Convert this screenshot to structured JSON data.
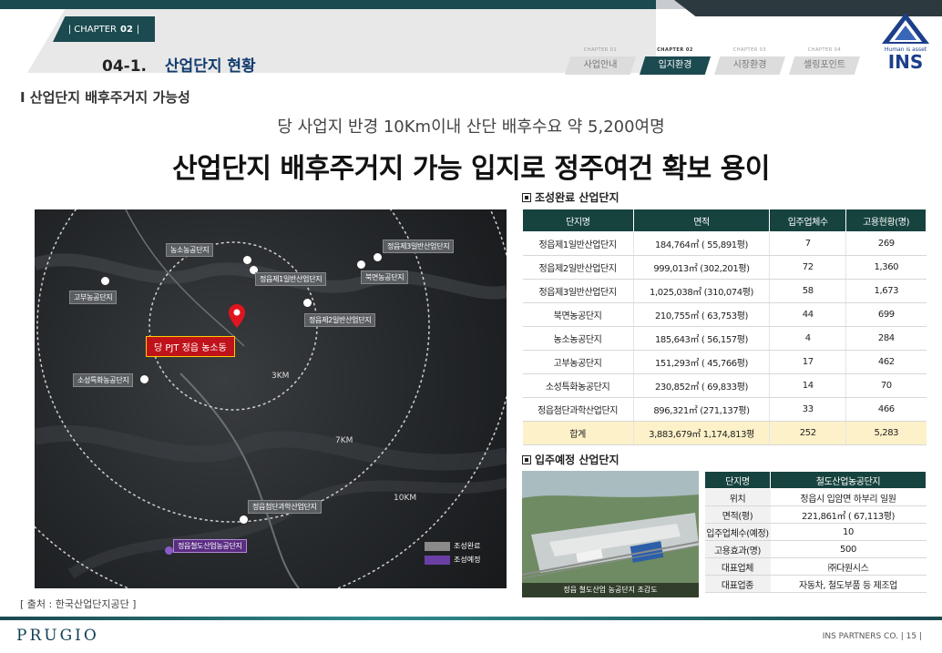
{
  "header": {
    "chapter_prefix": "| CHAPTER",
    "chapter_num": "02",
    "chapter_suffix": "|",
    "section_number": "04-1.",
    "section_title": "산업단지 현황",
    "nav": [
      {
        "caption": "CHAPTER 01",
        "label": "사업안내",
        "active": false
      },
      {
        "caption": "CHAPTER 02",
        "label": "입지환경",
        "active": true
      },
      {
        "caption": "CHAPTER 03",
        "label": "시장환경",
        "active": false
      },
      {
        "caption": "CHAPTER 04",
        "label": "셀링포인트",
        "active": false
      }
    ],
    "logo_tagline": "Human is asset",
    "logo_name": "INS"
  },
  "subheading": "I 산업단지 배후주거지 가능성",
  "summary": "당 사업지 반경 10Km이내 산단 배후수요 약 5,200여명",
  "headline": "산업단지 배후주거지 가능 입지로 정주여건 확보 용이",
  "map": {
    "labels": [
      {
        "text": "농소농공단지",
        "type": "complete"
      },
      {
        "text": "정읍제3일반산업단지",
        "type": "complete"
      },
      {
        "text": "정읍제1일반산업단지",
        "type": "complete"
      },
      {
        "text": "북면농공단지",
        "type": "complete"
      },
      {
        "text": "고부농공단지",
        "type": "complete"
      },
      {
        "text": "정읍제2일반산업단지",
        "type": "complete"
      },
      {
        "text": "소성특화농공단지",
        "type": "complete"
      },
      {
        "text": "정읍첨단과학산업단지",
        "type": "complete"
      },
      {
        "text": "정읍철도산업농공단지",
        "type": "planned"
      }
    ],
    "site_label": "당 PJT 정읍 농소동",
    "rings": [
      "3KM",
      "7KM",
      "10KM"
    ],
    "legend": [
      {
        "text": "조성완료",
        "color": "#8a8a8a"
      },
      {
        "text": "조성예정",
        "color": "#6a3fa5"
      }
    ]
  },
  "source": "[ 출처 : 한국산업단지공단 ]",
  "complete_table": {
    "title": "조성완료 산업단지",
    "headers": [
      "단지명",
      "면적",
      "입주업체수",
      "고용현황(명)"
    ],
    "rows": [
      [
        "정읍제1일반산업단지",
        "184,764㎡ ( 55,891평)",
        "7",
        "269"
      ],
      [
        "정읍제2일반산업단지",
        "999,013㎡ (302,201평)",
        "72",
        "1,360"
      ],
      [
        "정읍제3일반산업단지",
        "1,025,038㎡ (310,074평)",
        "58",
        "1,673"
      ],
      [
        "북면농공단지",
        "210,755㎡ ( 63,753평)",
        "44",
        "699"
      ],
      [
        "농소농공단지",
        "185,643㎡ ( 56,157평)",
        "4",
        "284"
      ],
      [
        "고부농공단지",
        "151,293㎡ ( 45,766평)",
        "17",
        "462"
      ],
      [
        "소성특화농공단지",
        "230,852㎡ ( 69,833평)",
        "14",
        "70"
      ],
      [
        "정읍첨단과학산업단지",
        "896,321㎡ (271,137평)",
        "33",
        "466"
      ]
    ],
    "total": [
      "합계",
      "3,883,679㎡ 1,174,813평",
      "252",
      "5,283"
    ]
  },
  "planned": {
    "title": "입주예정 산업단지",
    "photo_caption": "정읍 철도산업 농공단지 조감도",
    "headers": [
      "단지명",
      "철도산업농공단지"
    ],
    "rows": [
      [
        "위치",
        "정읍시 입암면 하부리 일원"
      ],
      [
        "면적(평)",
        "221,861㎡ ( 67,113평)"
      ],
      [
        "입주업체수(예정)",
        "10"
      ],
      [
        "고용효과(명)",
        "500"
      ],
      [
        "대표업체",
        "㈜다원시스"
      ],
      [
        "대표업종",
        "자동차, 철도부품 등 제조업"
      ]
    ]
  },
  "footer": {
    "brand": "PRUGIO",
    "right": "INS PARTNERS CO.  |  15  |"
  }
}
